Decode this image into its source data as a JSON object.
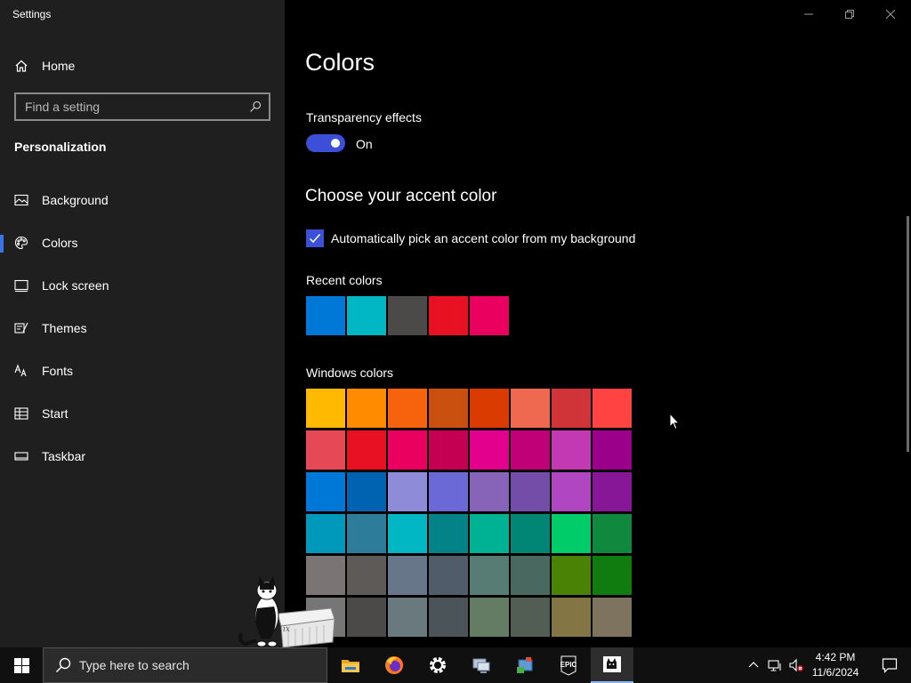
{
  "window": {
    "title": "Settings",
    "controls": [
      "minimize-icon",
      "restore-icon",
      "close-icon"
    ]
  },
  "sidebar": {
    "home_label": "Home",
    "search_placeholder": "Find a setting",
    "section_title": "Personalization",
    "selected": "Colors",
    "items": [
      {
        "label": "Background",
        "icon": "picture-icon"
      },
      {
        "label": "Colors",
        "icon": "palette-icon"
      },
      {
        "label": "Lock screen",
        "icon": "lock-screen-icon"
      },
      {
        "label": "Themes",
        "icon": "brush-icon"
      },
      {
        "label": "Fonts",
        "icon": "font-icon"
      },
      {
        "label": "Start",
        "icon": "start-menu-icon"
      },
      {
        "label": "Taskbar",
        "icon": "taskbar-icon"
      }
    ]
  },
  "main": {
    "title": "Colors",
    "transparency": {
      "label": "Transparency effects",
      "state": "On",
      "enabled": true
    },
    "accent_heading": "Choose your accent color",
    "auto_accent": {
      "label": "Automatically pick an accent color from my background",
      "checked": true
    },
    "accent_color": "#3b4fd9",
    "recent_label": "Recent colors",
    "recent_colors": [
      "#0078d7",
      "#00b7c3",
      "#4c4a48",
      "#e81123",
      "#ea005e"
    ],
    "windows_label": "Windows colors",
    "windows_colors": [
      [
        "#ffb900",
        "#ff8c00",
        "#f7630c",
        "#ca5010",
        "#da3b01",
        "#ef6950",
        "#d13438",
        "#ff4343"
      ],
      [
        "#e74856",
        "#e81123",
        "#ea005e",
        "#c30052",
        "#e3008c",
        "#bf0077",
        "#c239b3",
        "#9a0089"
      ],
      [
        "#0078d7",
        "#0063b1",
        "#8e8cd8",
        "#6b69d6",
        "#8764b8",
        "#744da9",
        "#b146c2",
        "#881798"
      ],
      [
        "#0099bc",
        "#2d7d9a",
        "#00b7c3",
        "#038387",
        "#00b294",
        "#018574",
        "#00cc6a",
        "#10893e"
      ],
      [
        "#7a7574",
        "#5d5a58",
        "#68768a",
        "#515c6b",
        "#567c73",
        "#486860",
        "#498205",
        "#107c10"
      ],
      [
        "#767676",
        "#4c4a48",
        "#69797e",
        "#4a5459",
        "#647c64",
        "#525e54",
        "#847545",
        "#7e735f"
      ]
    ]
  },
  "taskbar": {
    "search_placeholder": "Type here to search",
    "apps": [
      "file-explorer-icon",
      "firefox-icon",
      "settings-gear-icon",
      "network-pc-icon",
      "control-panel-icon",
      "epic-games-icon",
      "desktop-pet-app-icon"
    ],
    "active_app": "desktop-pet-app-icon",
    "epic_text": "EPIC",
    "tray": [
      "chevron-up-icon",
      "network-icon",
      "volume-muted-icon"
    ],
    "time": "4:42 PM",
    "date": "11/6/2024"
  }
}
